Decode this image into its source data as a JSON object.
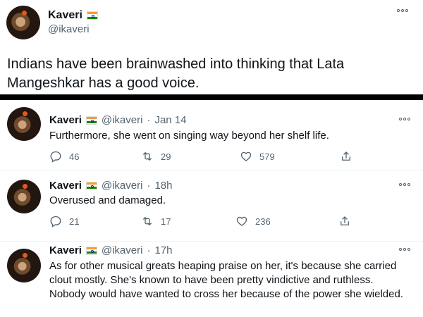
{
  "main_tweet": {
    "name": "Kaveri",
    "handle": "@ikaveri",
    "text": "Indians have been brainwashed into thinking that Lata Mangeshkar has a good voice."
  },
  "replies": [
    {
      "name": "Kaveri",
      "handle": "@ikaveri",
      "separator": "·",
      "time": "Jan 14",
      "text": "Furthermore, she went on singing way beyond her shelf life.",
      "reply_count": "46",
      "retweet_count": "29",
      "like_count": "579"
    },
    {
      "name": "Kaveri",
      "handle": "@ikaveri",
      "separator": "·",
      "time": "18h",
      "text": "Overused and damaged.",
      "reply_count": "21",
      "retweet_count": "17",
      "like_count": "236"
    },
    {
      "name": "Kaveri",
      "handle": "@ikaveri",
      "separator": "·",
      "time": "17h",
      "text": "As for other musical greats heaping praise on her, it's because she carried clout mostly. She's known to have been pretty vindictive and ruthless. Nobody would have wanted to cross her because of the power she wielded."
    }
  ],
  "icons": {
    "flag": "india-flag-icon",
    "more": "more-options-icon",
    "reply": "reply-icon",
    "retweet": "retweet-icon",
    "like": "like-icon",
    "share": "share-icon"
  },
  "colors": {
    "secondary_text": "#536471",
    "divider": "#000000",
    "thread_line": "#cfd9de"
  }
}
